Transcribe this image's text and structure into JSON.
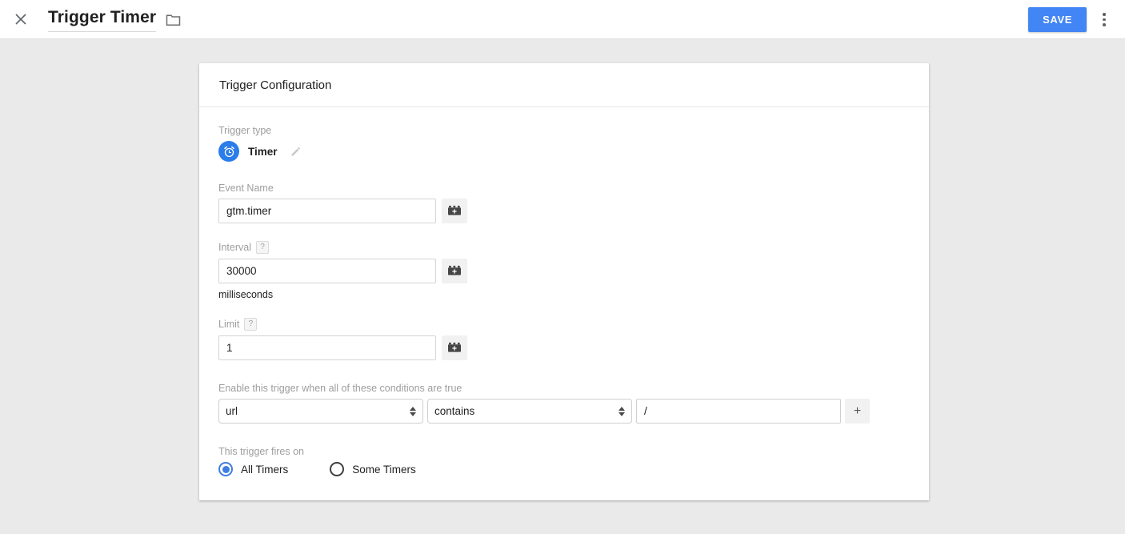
{
  "topbar": {
    "close_icon": "close-icon",
    "title": "Trigger Timer",
    "folder_icon": "folder-icon",
    "save_label": "SAVE",
    "overflow_icon": "more-vert-icon",
    "accent_color": "#4285f4"
  },
  "card": {
    "header_title": "Trigger Configuration"
  },
  "trigger_type": {
    "label": "Trigger type",
    "icon": "alarm-clock-icon",
    "icon_color": "#2b7de9",
    "name": "Timer",
    "edit_icon": "pencil-icon"
  },
  "event_name": {
    "label": "Event Name",
    "value": "gtm.timer",
    "placeholder": "",
    "variable_button_icon": "variable-brick-icon"
  },
  "interval": {
    "label": "Interval",
    "help_badge": "?",
    "value": "30000",
    "placeholder": "",
    "units": "milliseconds",
    "variable_button_icon": "variable-brick-icon"
  },
  "limit": {
    "label": "Limit",
    "help_badge": "?",
    "value": "1",
    "placeholder": "",
    "variable_button_icon": "variable-brick-icon"
  },
  "conditions": {
    "label": "Enable this trigger when all of these conditions are true",
    "variable_selected": "url",
    "operator_selected": "contains",
    "value": "/",
    "value_placeholder": "",
    "add_label": "+"
  },
  "fires_on": {
    "label": "This trigger fires on",
    "options": [
      {
        "label": "All Timers",
        "selected": true
      },
      {
        "label": "Some Timers",
        "selected": false
      }
    ]
  }
}
